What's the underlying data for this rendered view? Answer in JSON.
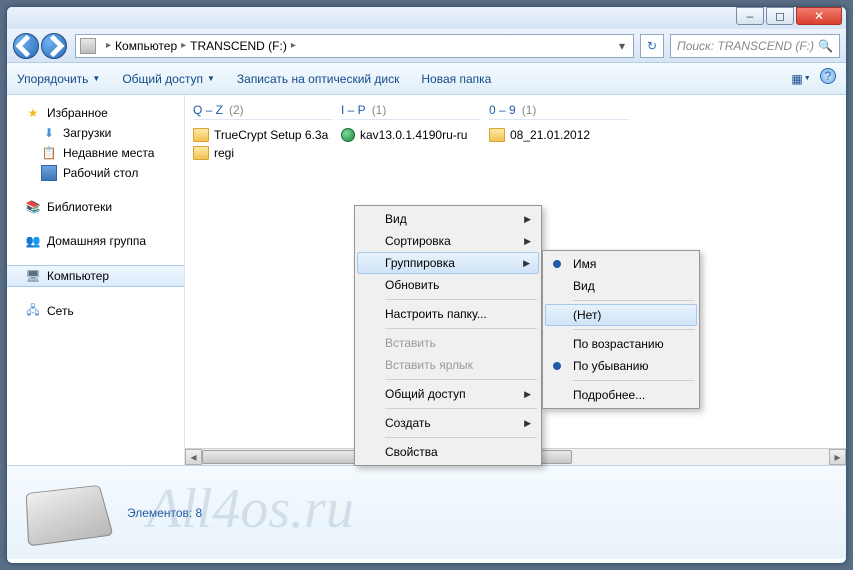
{
  "window_controls": {
    "min": "–",
    "max": "◻",
    "close": "✕"
  },
  "breadcrumb": {
    "root": "Компьютер",
    "drive": "TRANSCEND (F:)"
  },
  "search": {
    "placeholder": "Поиск: TRANSCEND (F:)"
  },
  "toolbar": {
    "organize": "Упорядочить",
    "share": "Общий доступ",
    "burn": "Записать на оптический диск",
    "newfolder": "Новая папка"
  },
  "sidebar": {
    "favorites": "Избранное",
    "downloads": "Загрузки",
    "recent": "Недавние места",
    "desktop": "Рабочий стол",
    "libraries": "Библиотеки",
    "homegroup": "Домашняя группа",
    "computer": "Компьютер",
    "network": "Сеть"
  },
  "groups": [
    {
      "title": "Q – Z",
      "count": "(2)",
      "items": [
        {
          "icon": "folder",
          "name": "TrueCrypt Setup 6.3a"
        },
        {
          "icon": "folder",
          "name": "regi"
        }
      ]
    },
    {
      "title": "I – P",
      "count": "(1)",
      "items": [
        {
          "icon": "exe",
          "name": "kav13.0.1.4190ru-ru"
        }
      ]
    },
    {
      "title": "0 – 9",
      "count": "(1)",
      "items": [
        {
          "icon": "folder",
          "name": "08_21.01.2012"
        }
      ]
    }
  ],
  "context_menu": {
    "view": "Вид",
    "sort": "Сортировка",
    "group": "Группировка",
    "refresh": "Обновить",
    "customize": "Настроить папку...",
    "paste": "Вставить",
    "paste_shortcut": "Вставить ярлык",
    "share": "Общий доступ",
    "new": "Создать",
    "properties": "Свойства"
  },
  "submenu": {
    "name": "Имя",
    "view": "Вид",
    "none": "(Нет)",
    "asc": "По возрастанию",
    "desc": "По убыванию",
    "more": "Подробнее..."
  },
  "details": {
    "label": "Элементов: 8"
  },
  "watermark": "All4os.ru"
}
